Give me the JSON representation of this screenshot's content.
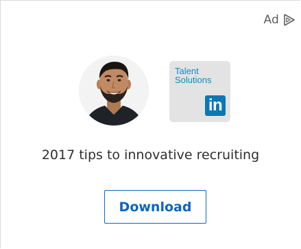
{
  "ad": {
    "label": "Ad",
    "choices_icon": "ad-choices-play-icon"
  },
  "creative": {
    "avatar_icon": "person-photo",
    "logo": {
      "line1": "Talent",
      "line2": "Solutions",
      "badge": "in",
      "badge_color": "#0a78b5",
      "text_color": "#0a8ec2"
    },
    "headline": "2017 tips to innovative recruiting"
  },
  "cta": {
    "label": "Download",
    "color": "#0a66c2"
  }
}
